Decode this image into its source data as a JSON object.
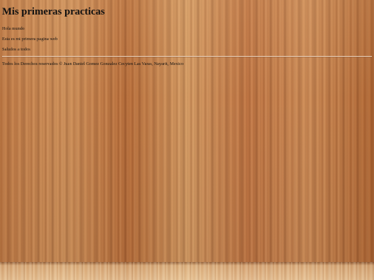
{
  "page": {
    "heading": "Mis primeras practicas",
    "paragraphs": [
      "Hola mundo",
      "Esta es mi primera pagina web",
      "Saludos a todos"
    ],
    "footer": "Todos los Derechos reservados © Juan Daniel Gomez Gonzalez Cecyten Las Varas, Nayarit, Mexico"
  },
  "colors": {
    "background": "#b8703e",
    "text": "#111111"
  }
}
